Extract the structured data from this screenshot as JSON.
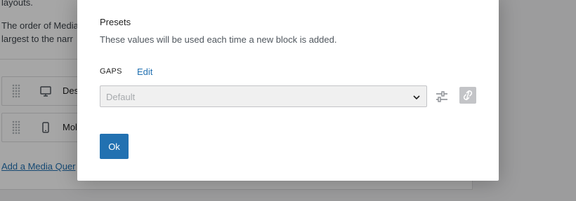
{
  "background": {
    "lines": [
      "layouts.",
      "The order of Media",
      "largest to the narr"
    ],
    "media_queries": [
      {
        "icon": "desktop-icon",
        "label": "Des"
      },
      {
        "icon": "mobile-icon",
        "label": "Mol"
      }
    ],
    "add_link": "Add a Media Quer"
  },
  "modal": {
    "title": "Presets",
    "description": "These values will be used each time a new block is added.",
    "gaps": {
      "label": "GAPS",
      "edit_label": "Edit",
      "select_value": "Default"
    },
    "ok_label": "Ok"
  },
  "colors": {
    "accent": "#2271b1",
    "link_button_bg": "#c3c4c7",
    "select_bg": "#f0f0f0"
  },
  "icons": {
    "select_chevron": "chevron-down-icon",
    "settings": "sliders-icon",
    "link": "unlink-icon"
  }
}
